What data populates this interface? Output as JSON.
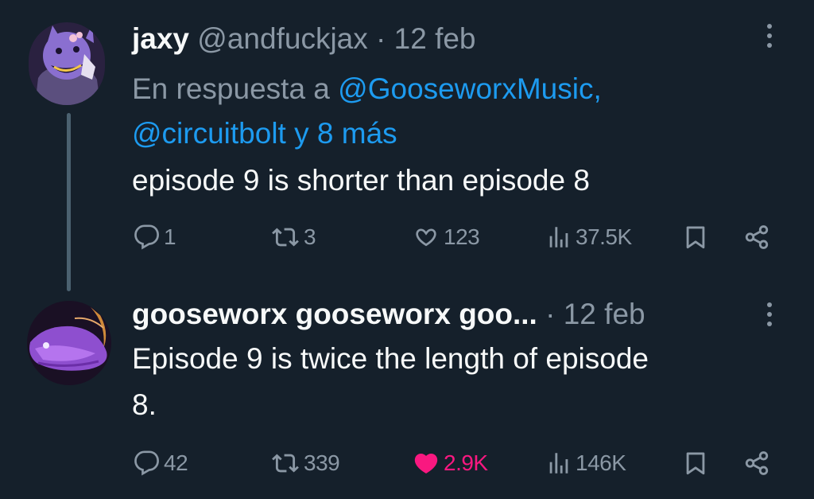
{
  "tweet1": {
    "display_name": "jaxy",
    "handle": "@andfuckjax",
    "separator": "·",
    "date": "12 feb",
    "reply_prefix": "En respuesta a ",
    "mention_1": "@GooseworxMusic,",
    "mention_2": "@circuitbolt y 8 más",
    "text": "episode 9 is shorter than episode 8",
    "replies": "1",
    "retweets": "3",
    "likes": "123",
    "views": "37.5K"
  },
  "tweet2": {
    "display_name": "gooseworx gooseworx goo...",
    "separator": "·",
    "date": "12 feb",
    "text_line1": "Episode 9 is twice the length of episode",
    "text_line2": "8.",
    "replies": "42",
    "retweets": "339",
    "likes": "2.9K",
    "liked": true,
    "views": "146K"
  },
  "colors": {
    "background": "#15202b",
    "primary_text": "#f7f9f9",
    "secondary_text": "#8b98a5",
    "mention": "#1d9bf0",
    "like_active": "#f91880",
    "thread_line": "#4b6170"
  },
  "icons": [
    "avatar",
    "more-icon",
    "reply-icon",
    "retweet-icon",
    "like-icon",
    "views-icon",
    "bookmark-icon",
    "share-icon"
  ]
}
